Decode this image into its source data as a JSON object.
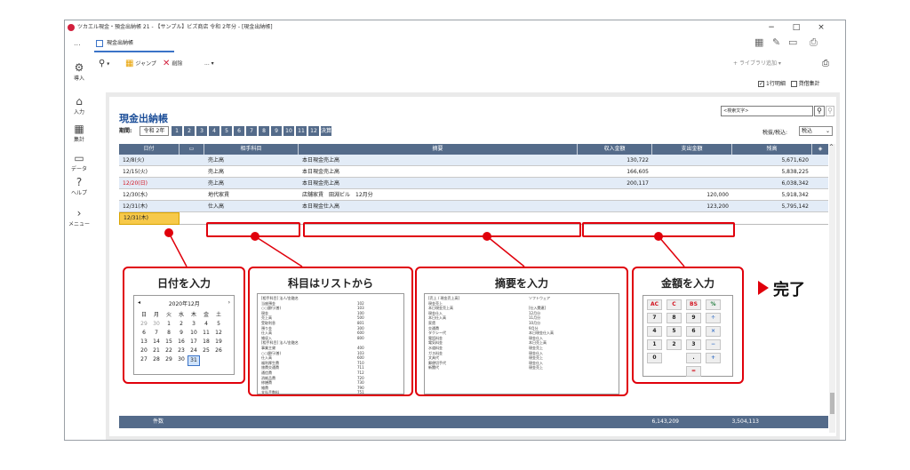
{
  "window": {
    "title": "ツカエル現金・預金出納帳 21 - 【サンプル】ビズ商店 令和 2年分 - [現金出納帳]",
    "tab_more": "...",
    "doc_tab": "現金出納帳",
    "controls": [
      "−",
      "□",
      "×"
    ]
  },
  "toolbar": {
    "jump": "ジャンプ",
    "delete": "削除",
    "more": "...",
    "library": "ライブラリ追加"
  },
  "rail": [
    "導入",
    "入力",
    "集計",
    "データ",
    "ヘルプ",
    "メニュー"
  ],
  "options": {
    "one_line": "1行明細",
    "tax_summary": "貸借集計"
  },
  "book": {
    "title": "現金出納帳",
    "search_placeholder": "<検索文字>",
    "period_label": "期間:",
    "year": "令和 2年",
    "months": [
      "1",
      "2",
      "3",
      "4",
      "5",
      "6",
      "7",
      "8",
      "9",
      "10",
      "11",
      "12",
      "決算"
    ],
    "tax_label": "税抜/税込:",
    "tax_value": "税込"
  },
  "table": {
    "headers": [
      "日付",
      "相手科目",
      "摘要",
      "収入金額",
      "支出金額",
      "残高"
    ],
    "rows": [
      {
        "date": "12/8(火)",
        "account": "売上高",
        "memo": "本日現金売上高",
        "income": "130,722",
        "expense": "",
        "balance": "5,671,620",
        "sunday": false
      },
      {
        "date": "12/15(火)",
        "account": "売上高",
        "memo": "本日現金売上高",
        "income": "166,605",
        "expense": "",
        "balance": "5,838,225",
        "sunday": false
      },
      {
        "date": "12/20(日)",
        "account": "売上高",
        "memo": "本日現金売上高",
        "income": "200,117",
        "expense": "",
        "balance": "6,038,342",
        "sunday": true
      },
      {
        "date": "12/30(水)",
        "account": "地代家賃",
        "memo": "店舗家賃　田淵ビル　12月分",
        "income": "",
        "expense": "120,000",
        "balance": "5,918,342",
        "sunday": false
      },
      {
        "date": "12/31(木)",
        "account": "仕入高",
        "memo": "本日現金仕入高",
        "income": "",
        "expense": "123,200",
        "balance": "5,795,142",
        "sunday": false
      }
    ],
    "input_date": "12/31(木)",
    "footer_label": "件数",
    "footer_income": "6,143,209",
    "footer_expense": "3,504,113"
  },
  "callouts": {
    "date": "日付を入力",
    "account": "科目はリストから",
    "memo": "摘要を入力",
    "amount": "金額を入力",
    "done": "完了"
  },
  "calendar": {
    "title": "2020年12月",
    "weekdays": [
      "日",
      "月",
      "火",
      "水",
      "木",
      "金",
      "土"
    ],
    "days": [
      "29",
      "30",
      "1",
      "2",
      "3",
      "4",
      "5",
      "6",
      "7",
      "8",
      "9",
      "10",
      "11",
      "12",
      "13",
      "14",
      "15",
      "16",
      "17",
      "18",
      "19",
      "20",
      "21",
      "22",
      "23",
      "24",
      "25",
      "26",
      "27",
      "28",
      "29",
      "30",
      "31"
    ],
    "selected": "31"
  },
  "account_list": {
    "lines": [
      "[相手科目] 法人/金融名",
      "当座預金",
      "○○銀行(普)",
      "現金",
      "売上高",
      "受取利息",
      "預り金",
      "仕入高",
      "雑収入",
      "[相手科目] 法人/金融名",
      "事業主貸",
      "○○銀行(普)",
      "仕入高",
      "福利厚生費",
      "旅費交通費",
      "通信費",
      "消耗品費",
      "修繕費",
      "雑費",
      "支払手数料",
      "広告宣伝費",
      "地代家賃",
      "【売上 / 収入】",
      "現金",
      "○○銀行",
      "当座預金",
      "受取手形"
    ],
    "codes": [
      "",
      "102",
      "103",
      "100",
      "500",
      "801",
      "300",
      "600",
      "800",
      "",
      "400",
      "103",
      "600",
      "710",
      "711",
      "712",
      "720",
      "730",
      "790",
      "751",
      "740",
      "760",
      "",
      "100",
      "101",
      "102",
      "110"
    ]
  },
  "memo_list": {
    "lines": [
      "[売上 / 現金売上高]",
      "現金売上",
      "本日現金売上高",
      "現金仕入",
      "本日仕入高",
      "家賃",
      "交通費",
      "タクシー代",
      "電話料金",
      "電気料金",
      "水道料金",
      "ガス料金",
      "文具代",
      "郵便切手代",
      "新聞代",
      "ソフトウェア",
      "",
      "[仕入関連]",
      "12月分",
      "11月分",
      "10月分",
      "9月分",
      "本日現金仕入高",
      "現金仕入",
      "本日売上高",
      "現金売上",
      "現金仕入",
      "現金売上",
      "現金仕入",
      "現金売上"
    ]
  },
  "calculator": {
    "keys": [
      "AC",
      "C",
      "BS",
      "%",
      "7",
      "8",
      "9",
      "÷",
      "4",
      "5",
      "6",
      "×",
      "1",
      "2",
      "3",
      "−",
      "0",
      "",
      ".",
      "+",
      "",
      "",
      "=",
      ""
    ]
  }
}
